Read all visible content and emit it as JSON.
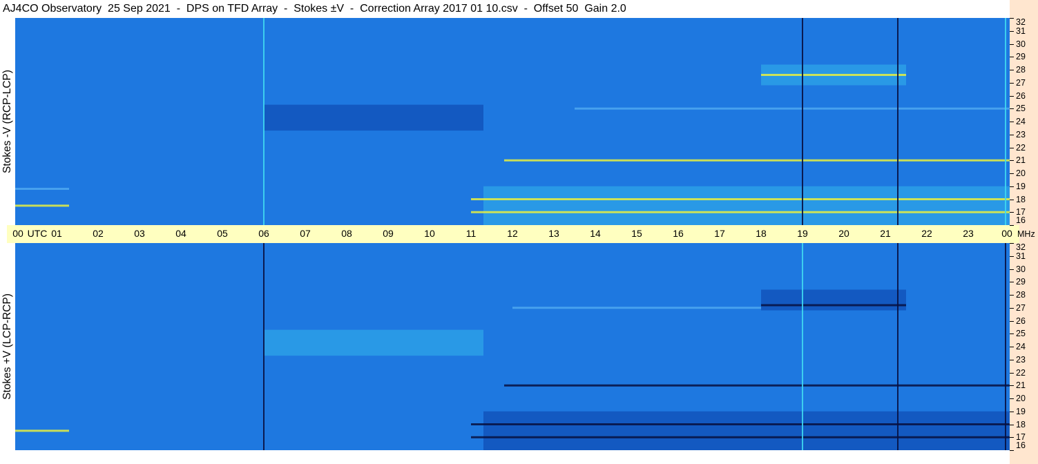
{
  "title": "AJ4CO Observatory  25 Sep 2021  -  DPS on TFD Array  -  Stokes ±V  -  Correction Array 2017 01 10.csv  -  Offset 50  Gain 2.0",
  "panels": {
    "top_label": "Stokes -V (RCP-LCP)",
    "bottom_label": "Stokes +V (LCP-RCP)"
  },
  "time_axis": {
    "unit_label": "UTC",
    "labels": [
      "00",
      "01",
      "02",
      "03",
      "04",
      "05",
      "06",
      "07",
      "08",
      "09",
      "10",
      "11",
      "12",
      "13",
      "14",
      "15",
      "16",
      "17",
      "18",
      "19",
      "20",
      "21",
      "22",
      "23",
      "00"
    ],
    "freq_unit": "MHz"
  },
  "freq_axis": {
    "labels": [
      "32",
      "31",
      "30",
      "29",
      "28",
      "27",
      "26",
      "25",
      "24",
      "23",
      "22",
      "21",
      "20",
      "19",
      "18",
      "17",
      "16"
    ]
  },
  "colors": {
    "background_blue": "#1e78e0",
    "dark_blue": "#0b3fa8",
    "cyan": "#3fd8f0",
    "yellow": "#e8f040",
    "black_trace": "#081040",
    "axis_band": "#ffffc0",
    "side_strip": "#ffe6cf"
  },
  "chart_data": {
    "type": "heatmap",
    "title": "AJ4CO Observatory  25 Sep 2021  -  DPS on TFD Array  -  Stokes ±V  -  Correction Array 2017 01 10.csv  -  Offset 50  Gain 2.0",
    "xlabel": "UTC",
    "ylabel": "MHz",
    "xlim": [
      0,
      24
    ],
    "ylim": [
      16,
      32
    ],
    "x_ticks": [
      "00",
      "01",
      "02",
      "03",
      "04",
      "05",
      "06",
      "07",
      "08",
      "09",
      "10",
      "11",
      "12",
      "13",
      "14",
      "15",
      "16",
      "17",
      "18",
      "19",
      "20",
      "21",
      "22",
      "23",
      "00"
    ],
    "y_ticks": [
      "32",
      "31",
      "30",
      "29",
      "28",
      "27",
      "26",
      "25",
      "24",
      "23",
      "22",
      "21",
      "20",
      "19",
      "18",
      "17",
      "16"
    ],
    "panels": [
      {
        "name": "Stokes -V (RCP-LCP)",
        "regions": [
          {
            "t0": 6.0,
            "t1": 11.3,
            "f0": 23.3,
            "f1": 25.3,
            "level": "dark"
          },
          {
            "t0": 11.3,
            "t1": 24.0,
            "f0": 16.0,
            "f1": 19.0,
            "level": "bright"
          },
          {
            "t0": 18.0,
            "t1": 21.5,
            "f0": 26.8,
            "f1": 28.4,
            "level": "bright"
          }
        ],
        "bands": [
          {
            "f": 21.0,
            "t0": 11.8,
            "t1": 24.0,
            "level": "bright"
          },
          {
            "f": 18.0,
            "t0": 11.0,
            "t1": 24.0,
            "level": "bright"
          },
          {
            "f": 17.0,
            "t0": 11.0,
            "t1": 24.0,
            "level": "bright"
          },
          {
            "f": 27.6,
            "t0": 18.0,
            "t1": 21.5,
            "level": "bright"
          },
          {
            "f": 25.0,
            "t0": 13.5,
            "t1": 24.0,
            "level": "faint"
          },
          {
            "f": 18.8,
            "t0": 0.0,
            "t1": 1.3,
            "level": "faint"
          },
          {
            "f": 17.5,
            "t0": 0.0,
            "t1": 1.3,
            "level": "bright"
          }
        ],
        "vertical_lines": [
          {
            "t": 6.0,
            "level": "bright"
          },
          {
            "t": 19.0,
            "level": "dark"
          },
          {
            "t": 21.3,
            "level": "dark"
          },
          {
            "t": 23.9,
            "level": "bright"
          }
        ]
      },
      {
        "name": "Stokes +V (LCP-RCP)",
        "regions": [
          {
            "t0": 6.0,
            "t1": 11.3,
            "f0": 23.3,
            "f1": 25.3,
            "level": "bright"
          },
          {
            "t0": 11.3,
            "t1": 24.0,
            "f0": 16.0,
            "f1": 19.0,
            "level": "dark"
          },
          {
            "t0": 18.0,
            "t1": 21.5,
            "f0": 26.8,
            "f1": 28.4,
            "level": "dark"
          }
        ],
        "bands": [
          {
            "f": 21.0,
            "t0": 11.8,
            "t1": 24.0,
            "level": "dark"
          },
          {
            "f": 18.0,
            "t0": 11.0,
            "t1": 24.0,
            "level": "dark"
          },
          {
            "f": 17.0,
            "t0": 11.0,
            "t1": 24.0,
            "level": "dark"
          },
          {
            "f": 27.2,
            "t0": 18.0,
            "t1": 21.5,
            "level": "dark"
          },
          {
            "f": 27.0,
            "t0": 12.0,
            "t1": 18.0,
            "level": "faint"
          },
          {
            "f": 17.5,
            "t0": 0.0,
            "t1": 1.3,
            "level": "bright"
          }
        ],
        "vertical_lines": [
          {
            "t": 6.0,
            "level": "dark"
          },
          {
            "t": 19.0,
            "level": "bright"
          },
          {
            "t": 21.3,
            "level": "dark"
          },
          {
            "t": 23.9,
            "level": "dark"
          }
        ]
      }
    ]
  }
}
